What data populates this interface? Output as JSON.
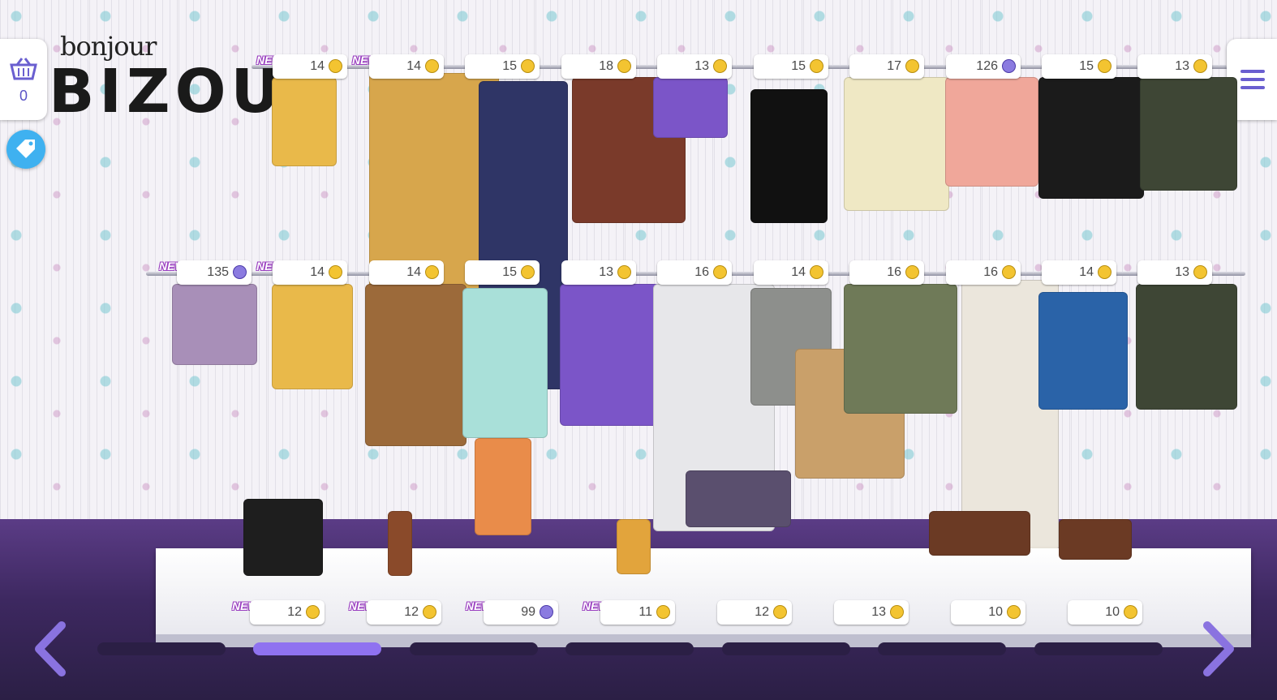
{
  "logo": {
    "line1": "bonjour",
    "line2": "BIZOU"
  },
  "cart": {
    "count": "0"
  },
  "new_badge": "NEW!",
  "top_row_prices": [
    {
      "amount": "14",
      "currency": "coin",
      "new": true
    },
    {
      "amount": "14",
      "currency": "coin",
      "new": true
    },
    {
      "amount": "15",
      "currency": "coin",
      "new": false
    },
    {
      "amount": "18",
      "currency": "coin",
      "new": false
    },
    {
      "amount": "13",
      "currency": "coin",
      "new": false
    },
    {
      "amount": "15",
      "currency": "coin",
      "new": false
    },
    {
      "amount": "17",
      "currency": "coin",
      "new": false
    },
    {
      "amount": "126",
      "currency": "gem",
      "new": false
    },
    {
      "amount": "15",
      "currency": "coin",
      "new": false
    },
    {
      "amount": "13",
      "currency": "coin",
      "new": false
    }
  ],
  "middle_row_prices": [
    {
      "amount": "135",
      "currency": "gem",
      "new": true
    },
    {
      "amount": "14",
      "currency": "coin",
      "new": true
    },
    {
      "amount": "14",
      "currency": "coin",
      "new": false
    },
    {
      "amount": "15",
      "currency": "coin",
      "new": false
    },
    {
      "amount": "13",
      "currency": "coin",
      "new": false
    },
    {
      "amount": "16",
      "currency": "coin",
      "new": false
    },
    {
      "amount": "14",
      "currency": "coin",
      "new": false
    },
    {
      "amount": "16",
      "currency": "coin",
      "new": false
    },
    {
      "amount": "16",
      "currency": "coin",
      "new": false
    },
    {
      "amount": "14",
      "currency": "coin",
      "new": false
    },
    {
      "amount": "13",
      "currency": "coin",
      "new": false
    }
  ],
  "shelf_prices": [
    {
      "amount": "12",
      "currency": "coin",
      "new": true
    },
    {
      "amount": "12",
      "currency": "coin",
      "new": true
    },
    {
      "amount": "99",
      "currency": "gem",
      "new": true
    },
    {
      "amount": "11",
      "currency": "coin",
      "new": true
    },
    {
      "amount": "12",
      "currency": "coin",
      "new": false
    },
    {
      "amount": "13",
      "currency": "coin",
      "new": false
    },
    {
      "amount": "10",
      "currency": "coin",
      "new": false
    },
    {
      "amount": "10",
      "currency": "coin",
      "new": false
    }
  ],
  "pagination": {
    "pages": 7,
    "active_index": 1
  },
  "colors": {
    "accent": "#8f72f0",
    "coin": "#f3c431",
    "gem": "#8b7be0",
    "floor": "#3d2860"
  },
  "icons": {
    "cart": "basket-icon",
    "tag": "price-tag-icon",
    "menu": "hamburger-menu-icon",
    "prev": "chevron-left-icon",
    "next": "chevron-right-icon"
  }
}
